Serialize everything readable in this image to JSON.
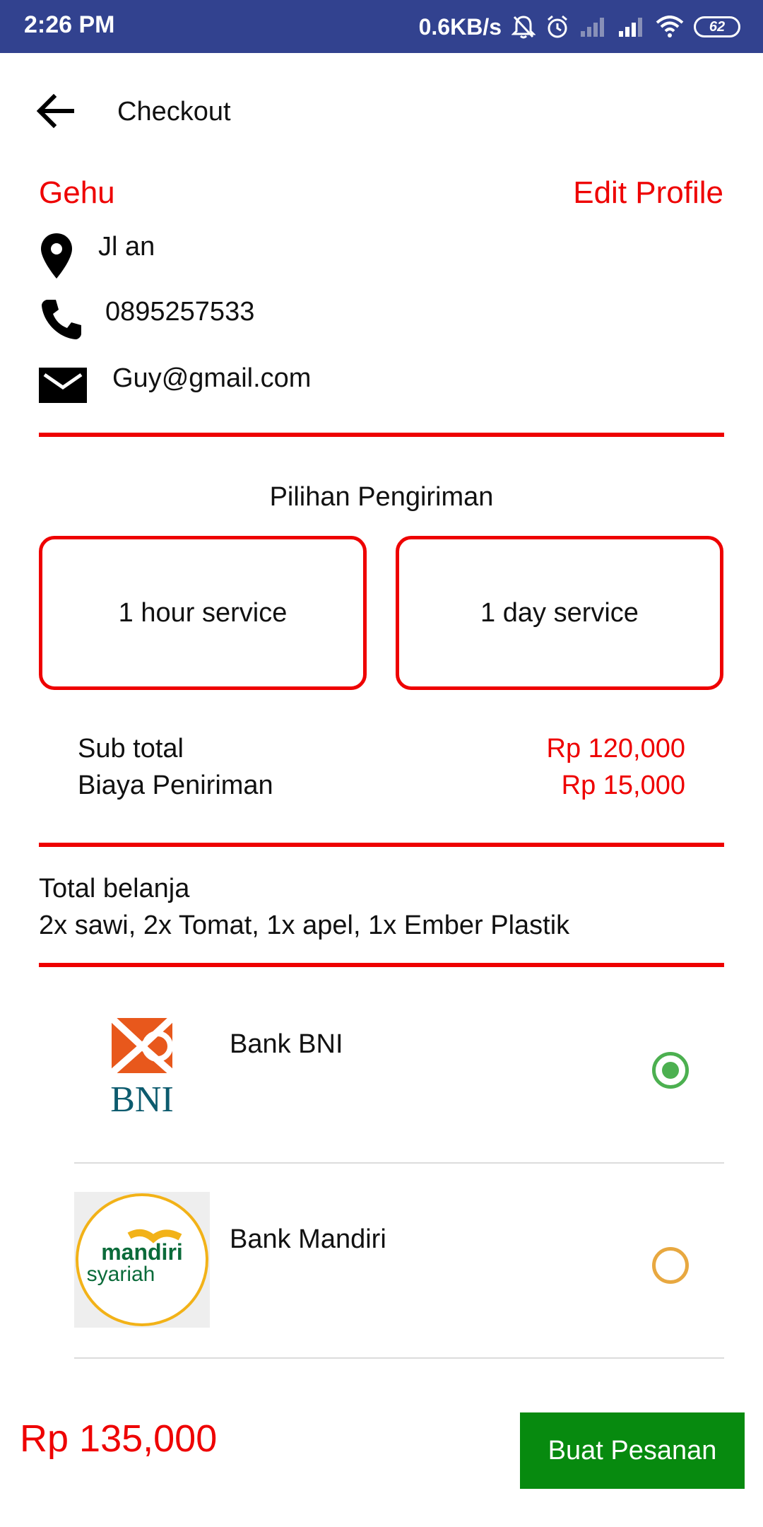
{
  "status_bar": {
    "time": "2:26 PM",
    "network_speed": "0.6KB/s",
    "battery": "62",
    "icons": [
      "notifications-off-icon",
      "alarm-icon",
      "signal-icon",
      "signal-icon",
      "wifi-icon",
      "battery-icon"
    ]
  },
  "app_bar": {
    "title": "Checkout",
    "back_icon": "arrow-back-icon"
  },
  "profile": {
    "name": "Gehu",
    "edit_label": "Edit Profile",
    "address": "Jl an",
    "phone": "0895257533",
    "email": "Guy@gmail.com"
  },
  "shipping": {
    "title": "Pilihan Pengiriman",
    "options": [
      {
        "label": "1 hour service"
      },
      {
        "label": "1 day service"
      }
    ]
  },
  "summary": {
    "subtotal_label": "Sub total",
    "subtotal_value": "Rp 120,000",
    "shipping_label": "Biaya Peniriman",
    "shipping_value": "Rp 15,000"
  },
  "cart": {
    "label": "Total belanja",
    "items": "2x sawi, 2x Tomat, 1x apel, 1x Ember Plastik"
  },
  "payment": {
    "banks": [
      {
        "name": "Bank BNI",
        "logo": "bni-logo",
        "logo_text": "BNI",
        "selected": true
      },
      {
        "name": "Bank Mandiri",
        "logo": "mandiri-syariah-logo",
        "logo_text": [
          "mandiri",
          "syariah"
        ],
        "selected": false
      }
    ]
  },
  "footer": {
    "total": "Rp 135,000",
    "order_button": "Buat Pesanan"
  },
  "colors": {
    "status_bar": "#32428f",
    "accent_red": "#ee0000",
    "button_green": "#078a0f",
    "radio_selected": "#4cb050",
    "radio_unselected": "#e8a840"
  }
}
